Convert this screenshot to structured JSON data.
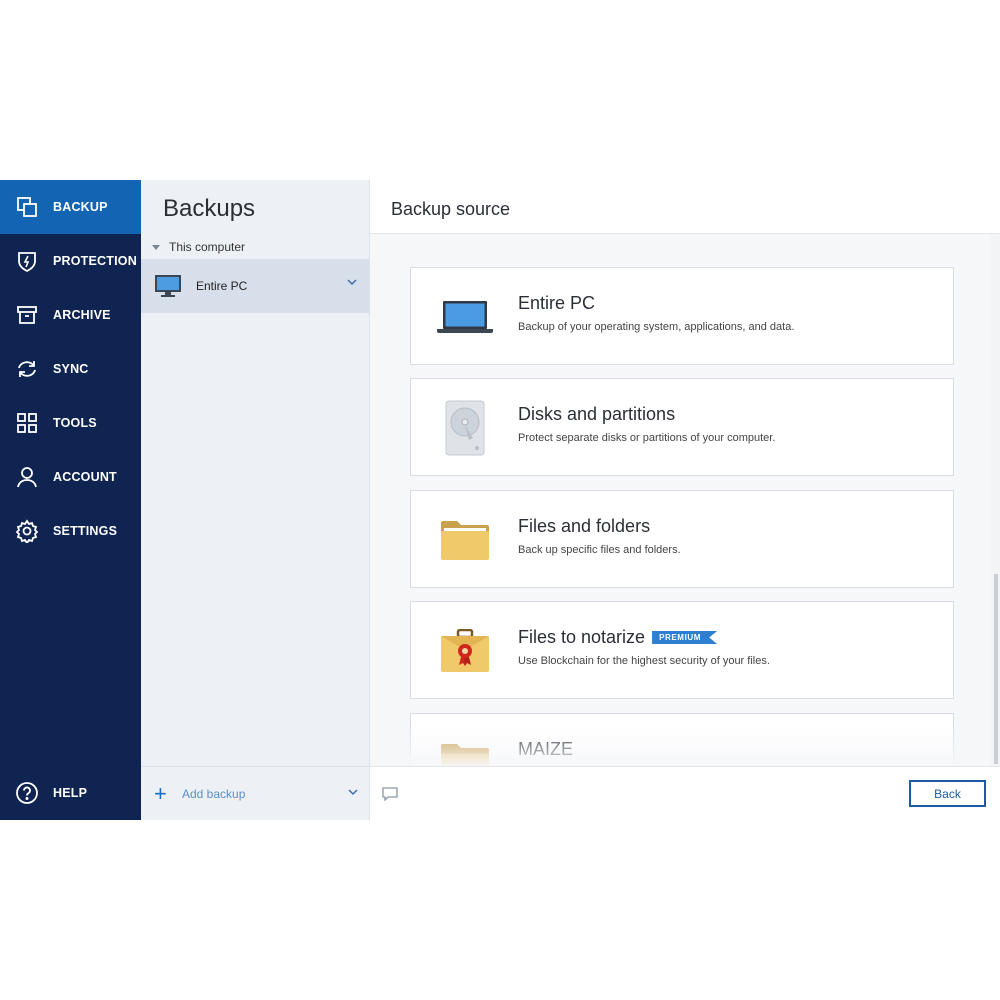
{
  "nav": {
    "items": [
      {
        "label": "BACKUP",
        "icon": "backup-icon",
        "active": true
      },
      {
        "label": "PROTECTION",
        "icon": "shield-icon"
      },
      {
        "label": "ARCHIVE",
        "icon": "archive-icon"
      },
      {
        "label": "SYNC",
        "icon": "sync-icon"
      },
      {
        "label": "TOOLS",
        "icon": "tools-icon"
      },
      {
        "label": "ACCOUNT",
        "icon": "account-icon"
      },
      {
        "label": "SETTINGS",
        "icon": "settings-icon"
      }
    ],
    "help": {
      "label": "HELP",
      "icon": "help-icon"
    }
  },
  "backups": {
    "title": "Backups",
    "group_label": "This computer",
    "selected_item": "Entire PC",
    "add_label": "Add backup"
  },
  "main": {
    "title": "Backup source",
    "sources": [
      {
        "title": "Entire PC",
        "desc": "Backup of your operating system, applications, and data.",
        "icon": "laptop-icon"
      },
      {
        "title": "Disks and partitions",
        "desc": "Protect separate disks or partitions of your computer.",
        "icon": "hard-disk-icon"
      },
      {
        "title": "Files and folders",
        "desc": "Back up specific files and folders.",
        "icon": "folder-icon"
      },
      {
        "title": "Files to notarize",
        "badge": "PREMIUM",
        "desc": "Use Blockchain for the highest security of your files.",
        "icon": "notarize-briefcase-icon"
      },
      {
        "title": "MAIZE",
        "desc": "",
        "icon": "nas-folder-icon"
      }
    ],
    "back_label": "Back"
  },
  "colors": {
    "nav_bg": "#0f2451",
    "nav_active": "#1464b4",
    "accent": "#1b5aa6",
    "premium_badge": "#2e7fd0"
  }
}
